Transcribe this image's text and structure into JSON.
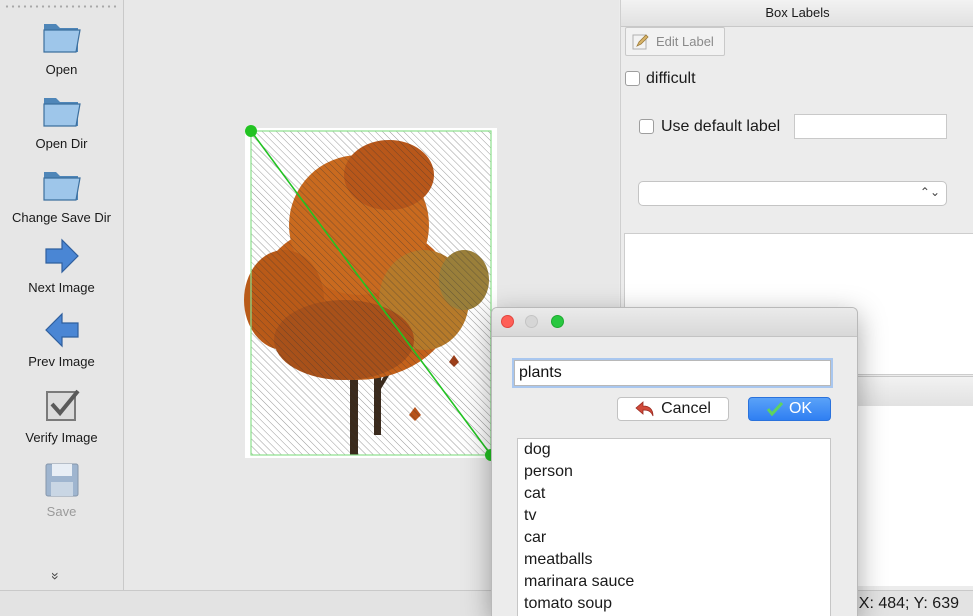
{
  "toolbar": {
    "items": [
      {
        "label": "Open",
        "icon": "folder-icon"
      },
      {
        "label": "Open Dir",
        "icon": "folder-icon"
      },
      {
        "label": "Change Save Dir",
        "icon": "folder-icon"
      },
      {
        "label": "Next Image",
        "icon": "arrow-right-icon"
      },
      {
        "label": "Prev Image",
        "icon": "arrow-left-icon"
      },
      {
        "label": "Verify Image",
        "icon": "checkbox-icon"
      },
      {
        "label": "Save",
        "icon": "floppy-disk-icon",
        "disabled": true
      }
    ],
    "more_icon": "»"
  },
  "right_dock": {
    "title": "Box Labels",
    "edit_label": "Edit Label",
    "difficult": "difficult",
    "use_default_label": "Use default label",
    "default_label_value": "",
    "combo_value": ""
  },
  "dialog": {
    "input_value": "plants",
    "cancel_label": "Cancel",
    "ok_label": "OK",
    "label_list": [
      "dog",
      "person",
      "cat",
      "tv",
      "car",
      "meatballs",
      "marinara sauce",
      "tomato soup"
    ]
  },
  "status_bar": {
    "text": "X: 484; Y: 639"
  },
  "colors": {
    "accent": "#2f7ff2",
    "bbox": "#22c322",
    "tree": "#c4611a"
  }
}
